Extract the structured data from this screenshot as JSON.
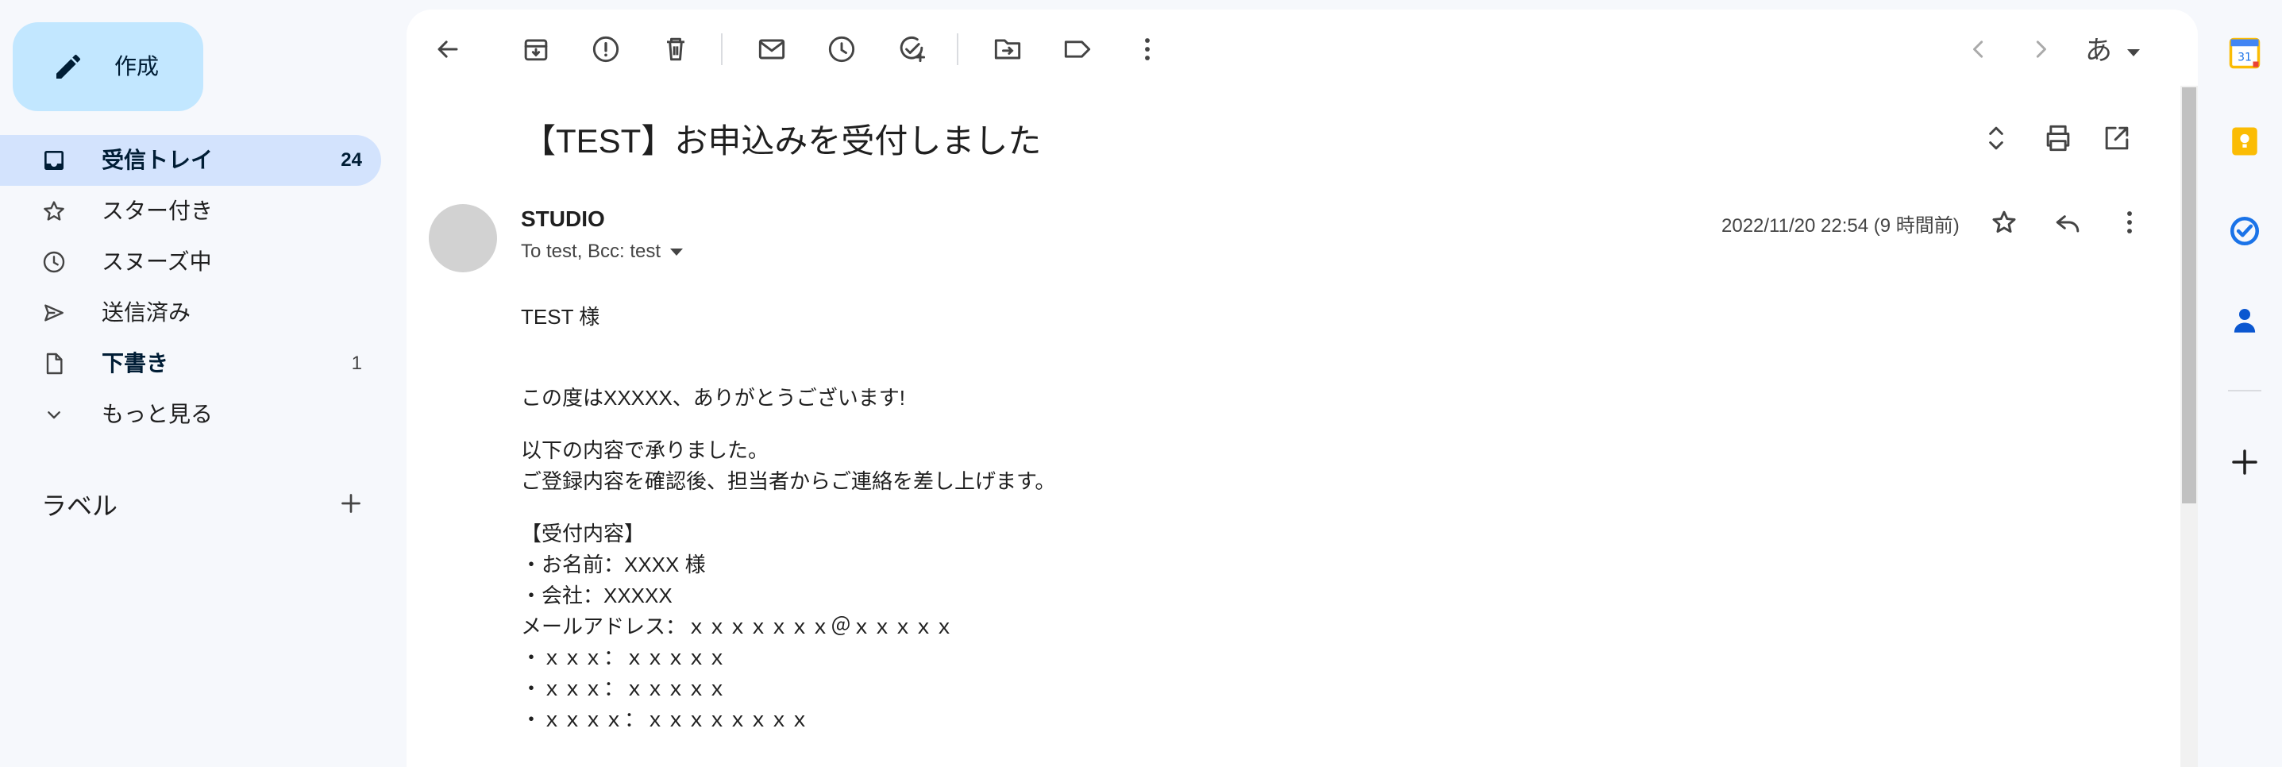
{
  "compose": {
    "label": "作成"
  },
  "nav": {
    "items": [
      {
        "label": "受信トレイ",
        "count": "24",
        "icon": "inbox-icon"
      },
      {
        "label": "スター付き",
        "count": "",
        "icon": "star-icon"
      },
      {
        "label": "スヌーズ中",
        "count": "",
        "icon": "clock-icon"
      },
      {
        "label": "送信済み",
        "count": "",
        "icon": "send-icon"
      },
      {
        "label": "下書き",
        "count": "1",
        "icon": "draft-icon"
      },
      {
        "label": "もっと見る",
        "count": "",
        "icon": "chevron-down-icon"
      }
    ]
  },
  "labels": {
    "title": "ラベル"
  },
  "toolbar": {
    "language": "あ"
  },
  "email": {
    "subject": "【TEST】お申込みを受付しました",
    "sender": "STUDIO",
    "recipients": "To test, Bcc: test",
    "date": "2022/11/20 22:54 (9 時間前)",
    "body": {
      "greeting": "TEST 様",
      "p1": "この度はXXXXX、ありがとうございます!",
      "p2_line1": "以下の内容で承りました。",
      "p2_line2": "ご登録内容を確認後、担当者からご連絡を差し上げます。",
      "section_title": "【受付内容】",
      "line1": "・お名前：XXXX 様",
      "line2": "・会社：XXXXX",
      "line3": "メールアドレス：ｘｘｘｘｘｘｘ＠ｘｘｘｘｘ",
      "line4": "・ｘｘｘ：ｘｘｘｘｘ",
      "line5": "・ｘｘｘ：ｘｘｘｘｘ",
      "line6": "・ｘｘｘｘ：ｘｘｘｘｘｘｘｘ"
    }
  },
  "rail": {
    "calendar_day": "31"
  },
  "colors": {
    "background": "#f6f8fc",
    "compose": "#c2e7ff",
    "active_nav": "#d3e3fd",
    "keep": "#fbbc04",
    "tasks": "#1a73e8",
    "contacts": "#0b57d0"
  }
}
